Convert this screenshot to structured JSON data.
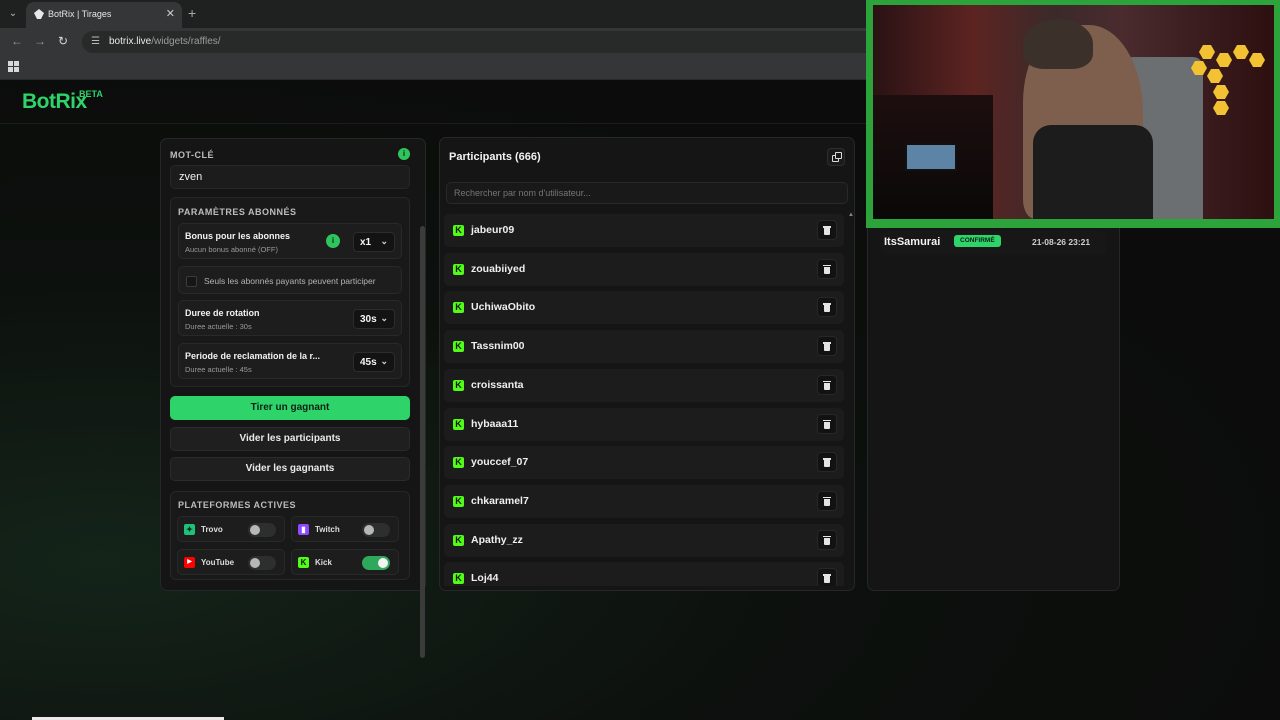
{
  "browser": {
    "tab_title": "BotRix | Tirages",
    "tab_close": "✕",
    "new_tab": "+",
    "url_host": "botrix.live",
    "url_path": "/widgets/raffles/"
  },
  "brand": {
    "name": "BotRix",
    "badge": "BETA"
  },
  "keyword": {
    "label": "MOT-CLÉ",
    "info": "i",
    "value": "zven"
  },
  "subscriber_settings": {
    "label": "PARAMÈTRES ABONNÉS",
    "bonus": {
      "title": "Bonus pour les abonnes",
      "subtitle": "Aucun bonus abonné (OFF)",
      "info": "i",
      "value": "x1"
    },
    "paid_only": {
      "label": "Seuls les abonnés payants peuvent participer",
      "checked": false
    },
    "rotation": {
      "title": "Duree de rotation",
      "subtitle": "Duree actuelle : 30s",
      "value": "30s"
    },
    "claim": {
      "title": "Periode de reclamation de la r...",
      "subtitle": "Duree actuelle : 45s",
      "value": "45s"
    }
  },
  "actions": {
    "draw": "Tirer un gagnant",
    "clear_participants": "Vider les participants",
    "clear_winners": "Vider les gagnants"
  },
  "platforms": {
    "label": "PLATEFORMES ACTIVES",
    "items": [
      {
        "name": "Trovo",
        "enabled": false,
        "color": "#1ec07a"
      },
      {
        "name": "Twitch",
        "enabled": false,
        "color": "#9146ff"
      },
      {
        "name": "YouTube",
        "enabled": false,
        "color": "#ff0000"
      },
      {
        "name": "Kick",
        "enabled": true,
        "color": "#53fc18"
      }
    ]
  },
  "participants": {
    "title": "Participants (666)",
    "search_placeholder": "Rechercher par nom d'utilisateur...",
    "items": [
      "jabeur09",
      "zouabiiyed",
      "UchiwaObito",
      "Tassnim00",
      "croissanta",
      "hybaaa11",
      "youccef_07",
      "chkaramel7",
      "Apathy_zz",
      "Loj44"
    ]
  },
  "winners": {
    "items": [
      {
        "name": "ItsSamurai",
        "status": "CONFIRMÉ",
        "time": "21-08-26 23:21"
      }
    ]
  },
  "colors": {
    "accent": "#2ed36a",
    "kick": "#53fc18",
    "webcam_frame": "#2ca33b"
  }
}
